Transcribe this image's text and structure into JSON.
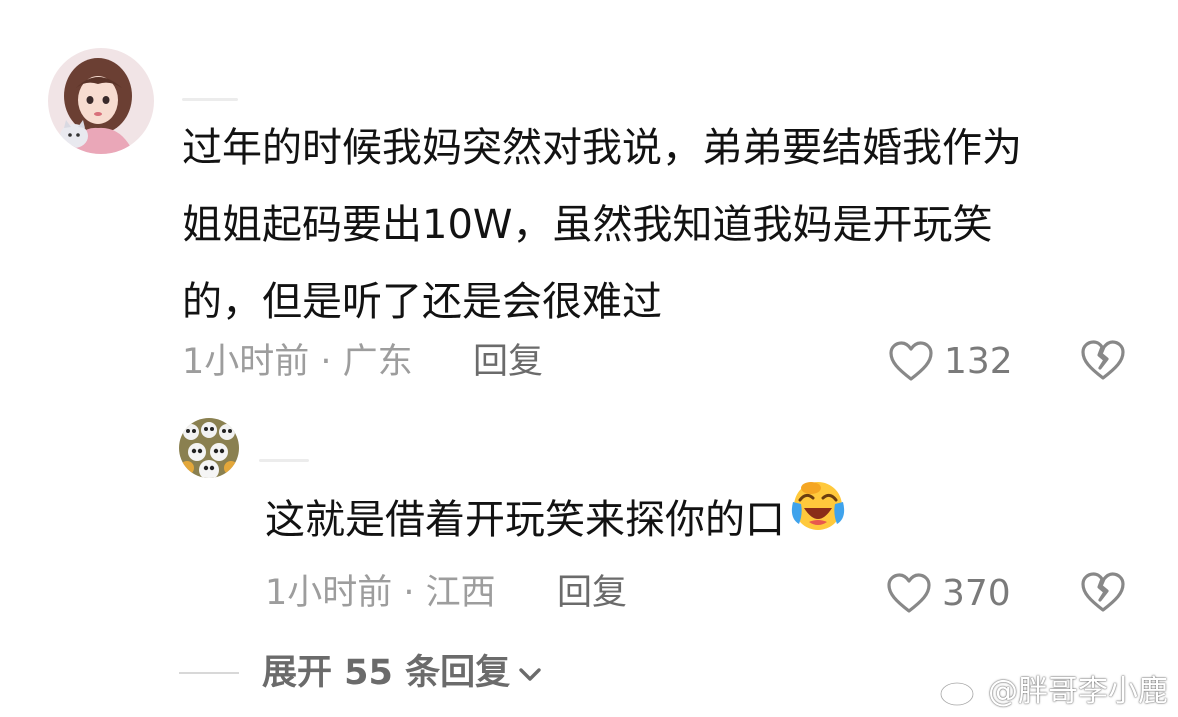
{
  "comment": {
    "line1": "过年的时候我妈突然对我说，弟弟要结婚我作为",
    "line2": "姐姐起码要出10W，虽然我知道我妈是开玩笑",
    "line3": "的，但是听了还是会很难过",
    "meta": "1小时前 · 广东",
    "reply_label": "回复",
    "likes": "132"
  },
  "reply": {
    "text": "这就是借着开玩笑来探你的口",
    "meta": "1小时前 · 江西",
    "reply_label": "回复",
    "likes": "370"
  },
  "expand_label": "展开 55 条回复",
  "watermark": "@胖哥李小鹿",
  "colors": {
    "text": "#121212",
    "meta": "#9d9d9d",
    "action": "#6b6b6b"
  }
}
